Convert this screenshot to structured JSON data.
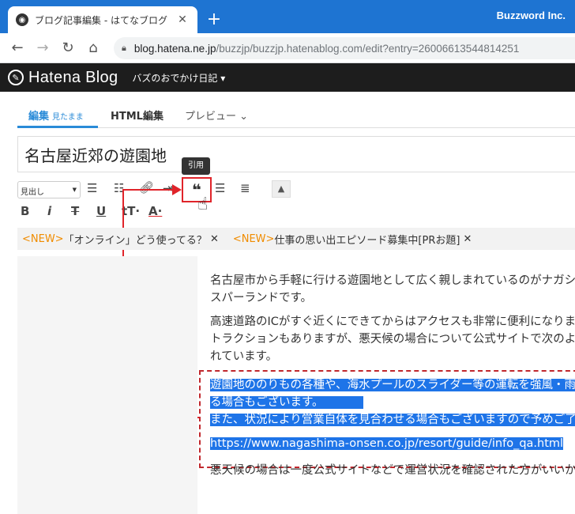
{
  "browser": {
    "tab_title": "ブログ記事編集 - はてなブログ",
    "brand": "Buzzword Inc.",
    "url_host": "blog.hatena.ne.jp",
    "url_path": "/buzzjp/buzzjp.hatenablog.com/edit?entry=26006613544814251"
  },
  "header": {
    "logo_text": "Hatena Blog",
    "blog_name": "バズのおでかけ日記 ▾"
  },
  "editor_tabs": {
    "edit": "編集",
    "edit_sub": "見たまま",
    "html": "HTML編集",
    "preview": "プレビュー"
  },
  "title": "名古屋近郊の遊園地",
  "toolbar": {
    "heading_select": "見出し",
    "tooltip": "引用"
  },
  "news": {
    "tag1": "<NEW>",
    "item1": "「オンライン」どう使ってる？",
    "tag2": "<NEW>",
    "item2": "仕事の思い出エピソード募集中[PRお題]"
  },
  "content": {
    "p1_l1": "名古屋市から手軽に行ける遊園地として広く親しまれているのがナガシマ",
    "p1_l2": "スパーランドです。",
    "p2_l1": "高速道路のICがすぐ近くにできてからはアクセスも非常に便利になりまし",
    "p2_l2": "トラクションもありますが、悪天候の場合について公式サイトで次のよう",
    "p2_l3": "れています。",
    "q_l1": "遊園地ののりもの各種や、海水プールのスライダー等の運転を強風・雨天",
    "q_l2": "る場合もございます。",
    "q_l3": "また、状況により営業自体を見合わせる場合もございますので予めご了承",
    "q_url": "https://www.nagashima-onsen.co.jp/resort/guide/info_qa.html",
    "p3_l1": "悪天候の場合は一度公式サイトなどで運営状況を確認された方がいいかも"
  },
  "colors": {
    "accent": "#1e74d2",
    "annotation": "#e0242a",
    "selection": "#1e74e8"
  }
}
